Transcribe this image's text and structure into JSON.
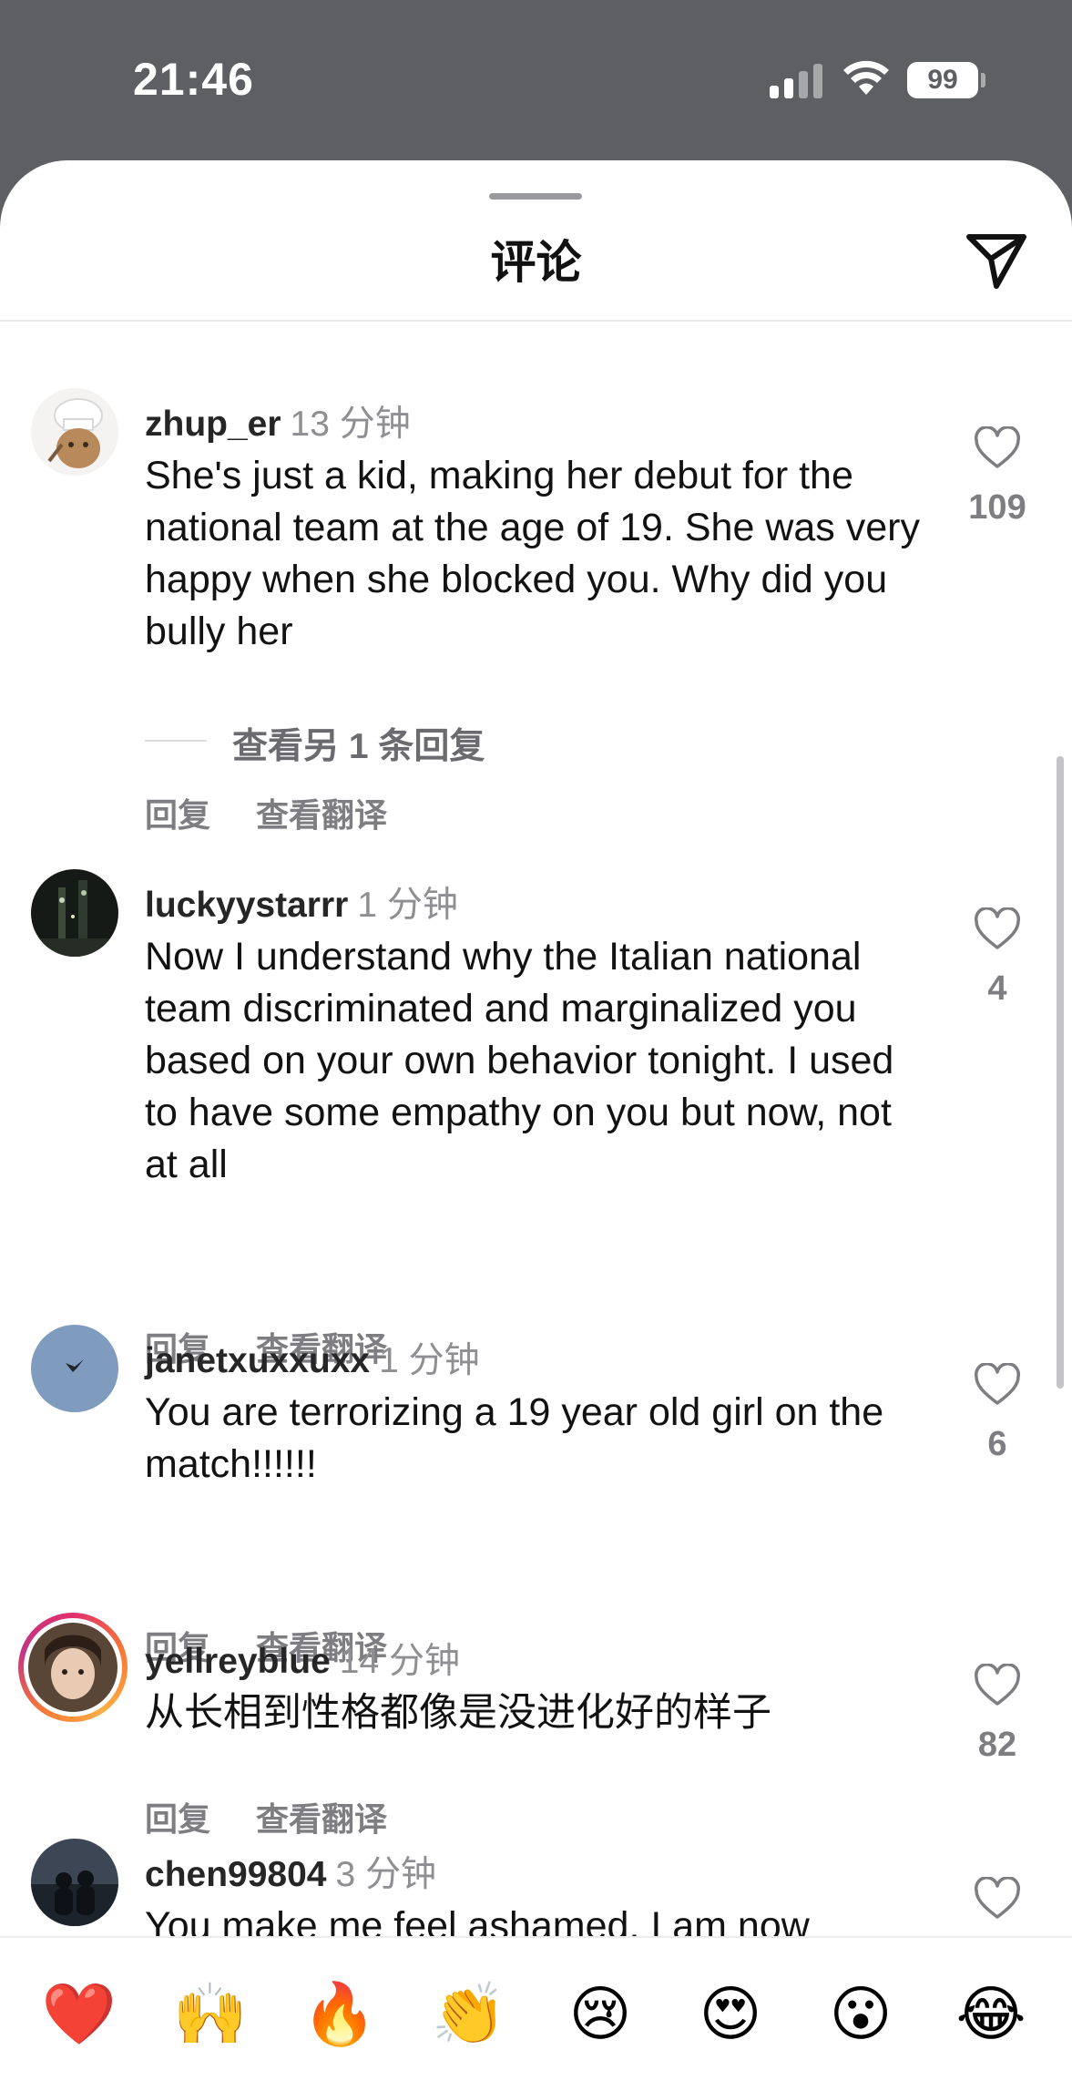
{
  "status": {
    "time": "21:46",
    "battery": "99"
  },
  "header": {
    "title": "评论",
    "send_icon": "send-icon"
  },
  "comments": [
    {
      "username": "zhup_er",
      "time": "13 分钟",
      "text": "She's just a kid, making her debut for the national team at the age of 19. She was very happy when she blocked you. Why did you bully her",
      "reply_label": "回复",
      "translate_label": "查看翻译",
      "likes": "109",
      "avatar_icon": "chef-cat-avatar"
    },
    {
      "username": "luckyystarrr",
      "time": "1 分钟",
      "text": "Now I understand why the Italian national team discriminated and marginalized you based on your own behavior tonight. I used to have some empathy on you but now, not at all",
      "reply_label": "回复",
      "translate_label": "查看翻译",
      "likes": "4",
      "avatar_icon": "night-city-avatar"
    },
    {
      "username": "janetxuxxuxx",
      "time": "1 分钟",
      "text": "You are terrorizing a 19 year old girl on the match!!!!!!",
      "reply_label": "回复",
      "translate_label": "查看翻译",
      "likes": "6",
      "avatar_icon": "bird-sky-avatar"
    },
    {
      "username": "yellreyblue",
      "time": "14 分钟",
      "text": "从长相到性格都像是没进化好的样子",
      "reply_label": "回复",
      "translate_label": "查看翻译",
      "likes": "82",
      "avatar_icon": "portrait-avatar-story-ring"
    },
    {
      "username": "chen99804",
      "time": "3 分钟",
      "text": "You make me feel ashamed. I am now",
      "avatar_icon": "silhouette-avatar"
    }
  ],
  "view_replies": "查看另 1 条回复",
  "emoji_bar": [
    {
      "icon": "red-heart-emoji",
      "glyph": "❤️"
    },
    {
      "icon": "raised-hands-emoji",
      "glyph": "🙌"
    },
    {
      "icon": "fire-emoji",
      "glyph": "🔥"
    },
    {
      "icon": "clapping-hands-emoji",
      "glyph": "👏"
    },
    {
      "icon": "crying-face-emoji",
      "glyph": "😢"
    },
    {
      "icon": "heart-eyes-emoji",
      "glyph": "😍"
    },
    {
      "icon": "surprised-face-emoji",
      "glyph": "😮"
    },
    {
      "icon": "tears-of-joy-emoji",
      "glyph": "😂"
    }
  ],
  "colors": {
    "sheet": "#ffffff",
    "backdrop": "#5e5f63",
    "secondary_text": "#8e8e93",
    "story_ring": "#e1306c"
  }
}
